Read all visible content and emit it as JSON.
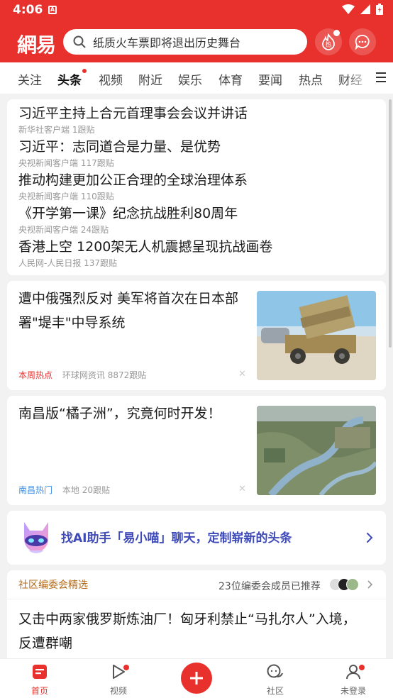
{
  "status": {
    "time": "4:06",
    "notif": "A"
  },
  "header": {
    "logo": "網易",
    "search_placeholder": "纸质火车票即将退出历史舞台",
    "hot_label": "热"
  },
  "tabs": [
    {
      "label": "关注",
      "active": false
    },
    {
      "label": "头条",
      "active": true
    },
    {
      "label": "视频",
      "active": false
    },
    {
      "label": "附近",
      "active": false
    },
    {
      "label": "娱乐",
      "active": false
    },
    {
      "label": "体育",
      "active": false
    },
    {
      "label": "要闻",
      "active": false
    },
    {
      "label": "热点",
      "active": false
    },
    {
      "label": "财经",
      "active": false
    }
  ],
  "hot_list": [
    {
      "title": "习近平主持上合元首理事会会议并讲话",
      "meta": "新华社客户端  1跟贴"
    },
    {
      "title": "习近平：志同道合是力量、是优势",
      "meta": "央视新闻客户端  117跟贴"
    },
    {
      "title": "推动构建更加公正合理的全球治理体系",
      "meta": "央视新闻客户端  110跟贴"
    },
    {
      "title": "《开学第一课》纪念抗战胜利80周年",
      "meta": "央视新闻客户端  24跟贴"
    },
    {
      "title": "香港上空 1200架无人机震撼呈现抗战画卷",
      "meta": "人民网-人民日报  137跟贴"
    }
  ],
  "news": [
    {
      "title": "遭中俄强烈反对 美军将首次在日本部署\"堤丰\"中导系统",
      "tag": "本周热点",
      "source": "环球网资讯",
      "comments": "8872跟贴",
      "tag_color": "#e8312d"
    },
    {
      "title": "南昌版“橘子洲”，究竟何时开发！",
      "tag": "南昌热门",
      "source": "本地",
      "comments": "20跟贴",
      "tag_color": "#3a8ee6"
    }
  ],
  "ai_banner": {
    "text": "找AI助手「易小喵」聊天，定制崭新的头条"
  },
  "community": {
    "label": "社区编委会精选",
    "recommend": "23位编委会成员已推荐",
    "title": "又击中两家俄罗斯炼油厂！匈牙利禁止“马扎尔人”入境，反遭群嘲"
  },
  "bottom_nav": [
    {
      "label": "首页"
    },
    {
      "label": "视频"
    },
    {
      "label": "社区"
    },
    {
      "label": "未登录"
    }
  ],
  "colors": {
    "brand": "#e8312d",
    "ai": "#3e4ab8"
  }
}
